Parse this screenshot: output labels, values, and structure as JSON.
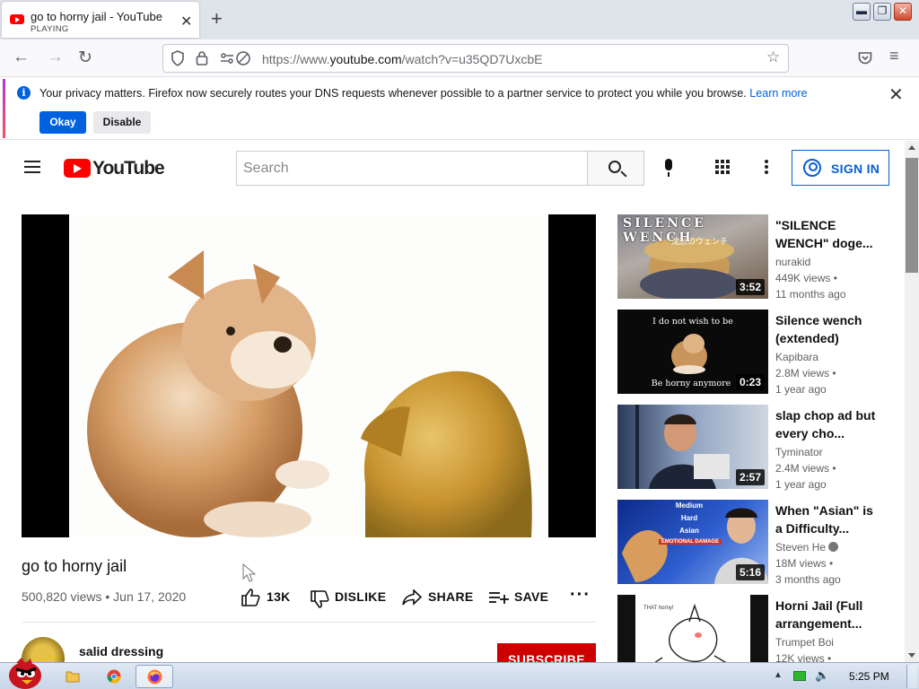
{
  "browser": {
    "tab_title": "go to horny jail - YouTube",
    "tab_subtitle": "PLAYING",
    "url_prefix": "https://www.",
    "url_domain": "youtube.com",
    "url_path": "/watch?v=u35QD7UxcbE"
  },
  "notification": {
    "message": "Your privacy matters. Firefox now securely routes your DNS requests whenever possible to a partner service to protect you while you browse.",
    "learn_more": "Learn more",
    "okay_label": "Okay",
    "disable_label": "Disable"
  },
  "youtube": {
    "logo_text": "YouTube",
    "search_placeholder": "Search",
    "sign_in_label": "SIGN IN"
  },
  "video": {
    "title": "go to horny jail",
    "meta": "500,820 views • Jun 17, 2020",
    "likes": "13K",
    "dislike_label": "DISLIKE",
    "share_label": "SHARE",
    "save_label": "SAVE",
    "channel_name": "salid dressing",
    "subscribe_label": "SUBSCRIBE"
  },
  "recommendations": [
    {
      "title": "\"SILENCE WENCH\" doge...",
      "channel": "nurakid",
      "views": "449K views •",
      "age": "11 months ago",
      "duration": "3:52",
      "thumb_text": "SILENCE WENCH"
    },
    {
      "title": "Silence wench (extended)",
      "channel": "Kapibara",
      "views": "2.8M views •",
      "age": "1 year ago",
      "duration": "0:23",
      "thumb_top": "I do not wish to be",
      "thumb_bottom": "Be horny anymore"
    },
    {
      "title": "slap chop ad but every cho...",
      "channel": "Tyminator",
      "views": "2.4M views •",
      "age": "1 year ago",
      "duration": "2:57"
    },
    {
      "title": "When \"Asian\" is a Difficulty...",
      "channel": "Steven He",
      "views": "18M views •",
      "age": "3 months ago",
      "duration": "5:16",
      "thumb_levels": [
        "Medium",
        "Hard",
        "Asian",
        "EMOTIONAL DAMAGE"
      ]
    },
    {
      "title": "Horni Jail (Full arrangement...",
      "channel": "Trumpet Boi",
      "views": "12K views •",
      "age": "",
      "duration": "",
      "thumb_text": "THAT horny!"
    }
  ],
  "taskbar": {
    "clock": "5:25 PM"
  },
  "colors": {
    "youtube_red": "#ff0000",
    "firefox_blue": "#0061e0",
    "link_blue": "#065fd4",
    "subscribe_red": "#cc0000"
  }
}
